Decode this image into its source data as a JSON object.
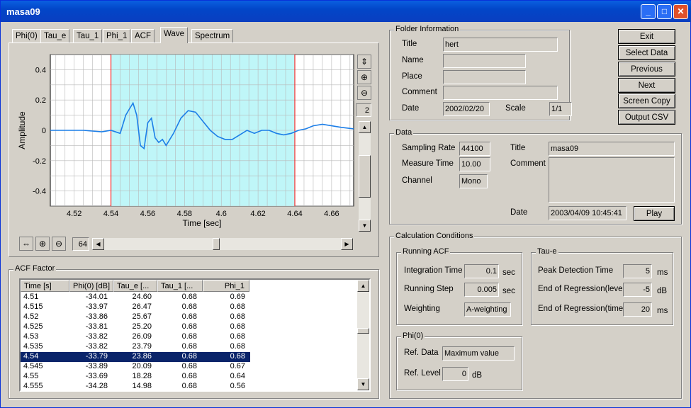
{
  "window": {
    "title": "masa09",
    "minimize": "_",
    "maximize": "□",
    "close": "✕"
  },
  "tabs": [
    "Phi(0)",
    "Tau_e",
    "Tau_1",
    "Phi_1",
    "ACF",
    "Wave",
    "Spectrum"
  ],
  "active_tab": "Wave",
  "chart_data": {
    "type": "line",
    "title": "",
    "xlabel": "Time [sec]",
    "ylabel": "Amplitude",
    "xlim": [
      4.507,
      4.672
    ],
    "ylim": [
      -0.5,
      0.5
    ],
    "xticks": [
      4.52,
      4.54,
      4.56,
      4.58,
      4.6,
      4.62,
      4.64,
      4.66
    ],
    "xtick_labels": [
      "4.52",
      "4.54",
      "4.56",
      "4.58",
      "4.6",
      "4.62",
      "4.64",
      "4.66"
    ],
    "yticks": [
      0.4,
      0.2,
      0,
      -0.2,
      -0.4
    ],
    "ytick_labels": [
      "0.4",
      "0.2",
      "0",
      "-0.2",
      "-0.4"
    ],
    "grid": true,
    "highlight_range": [
      4.54,
      4.64
    ],
    "highlight_color": "#bff6f8",
    "line_color": "#1c7ee8",
    "series": [
      {
        "x": [
          4.507,
          4.515,
          4.525,
          4.535,
          4.54,
          4.545,
          4.548,
          4.55,
          4.552,
          4.554,
          4.556,
          4.558,
          4.56,
          4.562,
          4.564,
          4.566,
          4.568,
          4.57,
          4.574,
          4.578,
          4.582,
          4.586,
          4.59,
          4.594,
          4.598,
          4.602,
          4.606,
          4.61,
          4.614,
          4.618,
          4.622,
          4.626,
          4.63,
          4.634,
          4.638,
          4.642,
          4.646,
          4.65,
          4.655,
          4.66,
          4.665,
          4.672
        ],
        "y": [
          0.0,
          0.0,
          0.0,
          -0.01,
          0.0,
          -0.02,
          0.1,
          0.14,
          0.18,
          0.1,
          -0.1,
          -0.12,
          0.05,
          0.08,
          -0.05,
          -0.08,
          -0.06,
          -0.1,
          -0.02,
          0.08,
          0.13,
          0.12,
          0.06,
          0.0,
          -0.04,
          -0.06,
          -0.06,
          -0.03,
          0.0,
          -0.02,
          0.0,
          0.0,
          -0.02,
          -0.03,
          -0.02,
          0.0,
          0.01,
          0.03,
          0.04,
          0.03,
          0.02,
          0.01
        ]
      }
    ]
  },
  "zoom": {
    "vertical_value": "2",
    "horizontal_value": "64"
  },
  "acf": {
    "label": "ACF Factor",
    "headers": [
      "Time [s]",
      "Phi(0) [dB]",
      "Tau_e [...",
      "Tau_1 [...",
      "Phi_1"
    ],
    "rows": [
      [
        "4.51",
        "-34.01",
        "24.60",
        "0.68",
        "0.69"
      ],
      [
        "4.515",
        "-33.97",
        "26.47",
        "0.68",
        "0.68"
      ],
      [
        "4.52",
        "-33.86",
        "25.67",
        "0.68",
        "0.68"
      ],
      [
        "4.525",
        "-33.81",
        "25.20",
        "0.68",
        "0.68"
      ],
      [
        "4.53",
        "-33.82",
        "26.09",
        "0.68",
        "0.68"
      ],
      [
        "4.535",
        "-33.82",
        "23.79",
        "0.68",
        "0.68"
      ],
      [
        "4.54",
        "-33.79",
        "23.86",
        "0.68",
        "0.68"
      ],
      [
        "4.545",
        "-33.89",
        "20.09",
        "0.68",
        "0.67"
      ],
      [
        "4.55",
        "-33.69",
        "18.28",
        "0.68",
        "0.64"
      ],
      [
        "4.555",
        "-34.28",
        "14.98",
        "0.68",
        "0.56"
      ]
    ],
    "selected_row": 6
  },
  "folder": {
    "label": "Folder Information",
    "title_label": "Title",
    "title": "hert",
    "name_label": "Name",
    "name": "",
    "place_label": "Place",
    "place": "",
    "comment_label": "Comment",
    "comment": "",
    "date_label": "Date",
    "date": "2002/02/20",
    "scale_label": "Scale",
    "scale": "1/1"
  },
  "buttons": {
    "exit": "Exit",
    "select_data": "Select Data",
    "previous": "Previous",
    "next": "Next",
    "screen_copy": "Screen Copy",
    "output_csv": "Output CSV",
    "play": "Play"
  },
  "data": {
    "label": "Data",
    "sampling_rate_label": "Sampling Rate",
    "sampling_rate": "44100",
    "measure_time_label": "Measure Time",
    "measure_time": "10.00",
    "channel_label": "Channel",
    "channel": "Mono",
    "title_label": "Title",
    "title": "masa09",
    "comment_label": "Comment",
    "comment": "",
    "date_label": "Date",
    "date": "2003/04/09 10:45:41"
  },
  "calc": {
    "label": "Calculation Conditions",
    "running": {
      "label": "Running ACF",
      "integration_label": "Integration Time",
      "integration": "0.1",
      "integration_unit": "sec",
      "step_label": "Running Step",
      "step": "0.005",
      "step_unit": "sec",
      "weighting_label": "Weighting",
      "weighting": "A-weighting"
    },
    "taue": {
      "label": "Tau-e",
      "peak_label": "Peak Detection Time",
      "peak": "5",
      "peak_unit": "ms",
      "reg_level_label": "End of Regression(level)",
      "reg_level": "-5",
      "reg_level_unit": "dB",
      "reg_time_label": "End of Regression(time)",
      "reg_time": "20",
      "reg_time_unit": "ms"
    },
    "phi0": {
      "label": "Phi(0)",
      "ref_data_label": "Ref. Data",
      "ref_data": "Maximum value",
      "ref_level_label": "Ref. Level",
      "ref_level": "0",
      "ref_level_unit": "dB"
    }
  }
}
